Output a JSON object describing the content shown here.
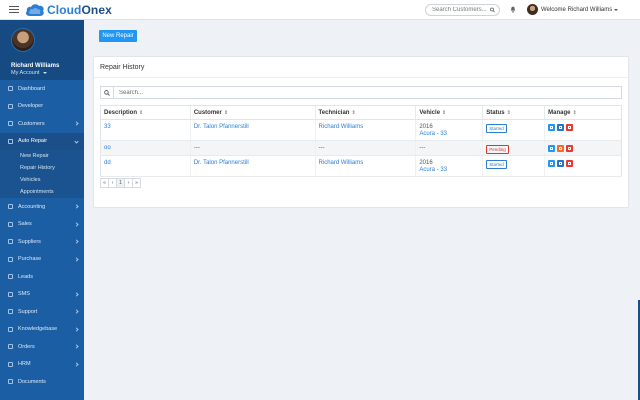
{
  "app": {
    "brand_first": "Cloud",
    "brand_second": "Onex",
    "search_placeholder": "Search Customers...",
    "welcome": "Welcome Richard Williams"
  },
  "sidebar": {
    "user_name": "Richard Williams",
    "account_label": "My Account",
    "items": [
      {
        "label": "Dashboard",
        "chevron": false
      },
      {
        "label": "Developer",
        "chevron": false
      },
      {
        "label": "Customers",
        "chevron": true
      },
      {
        "label": "Auto Repair",
        "chevron": true,
        "active": true
      },
      {
        "label": "Accounting",
        "chevron": true
      },
      {
        "label": "Sales",
        "chevron": true
      },
      {
        "label": "Suppliers",
        "chevron": true
      },
      {
        "label": "Purchase",
        "chevron": true
      },
      {
        "label": "Leads",
        "chevron": false
      },
      {
        "label": "SMS",
        "chevron": true
      },
      {
        "label": "Support",
        "chevron": true
      },
      {
        "label": "Knowledgebase",
        "chevron": true
      },
      {
        "label": "Orders",
        "chevron": true
      },
      {
        "label": "HRM",
        "chevron": true
      },
      {
        "label": "Documents",
        "chevron": false
      }
    ],
    "submenu": [
      "New Repair",
      "Repair History",
      "Vehicles",
      "Appointments"
    ]
  },
  "main": {
    "new_button": "New Repair",
    "panel_title": "Repair History",
    "table_search_placeholder": "Search...",
    "columns": [
      "Description",
      "Customer",
      "Technician",
      "Vehicle",
      "Status",
      "Manage"
    ],
    "sort_glyph": "⇕",
    "rows": [
      {
        "description": "33",
        "customer": "Dr. Talon Pfannerstill",
        "technician": "Richard Williams",
        "vehicle_year": "2016",
        "vehicle_name": "Acura - 33",
        "status": "Started",
        "status_type": "started"
      },
      {
        "description": "oo",
        "customer": "---",
        "technician": "---",
        "vehicle_year": "---",
        "vehicle_name": "",
        "status": "Pending",
        "status_type": "pending"
      },
      {
        "description": "dd",
        "customer": "Dr. Talon Pfannerstill",
        "technician": "Richard Williams",
        "vehicle_year": "2016",
        "vehicle_name": "Acura - 33",
        "status": "Started",
        "status_type": "started"
      }
    ],
    "pager": [
      "«",
      "‹",
      "1",
      "›",
      "»"
    ]
  },
  "colors": {
    "sidebar": "#1b5ea4",
    "accent": "#2196f3",
    "danger": "#e53935",
    "warning": "#f26b2a"
  }
}
